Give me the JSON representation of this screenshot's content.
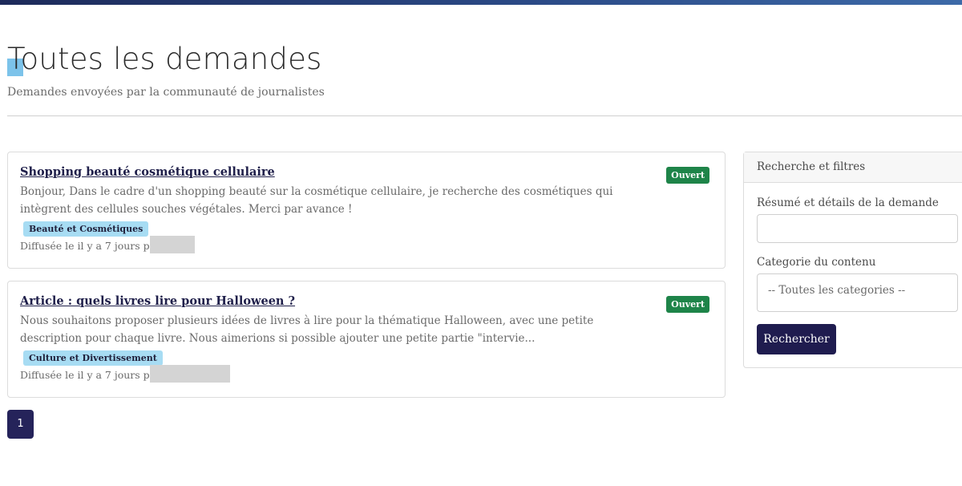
{
  "header": {
    "title": "Toutes les demandes",
    "subtitle": "Demandes envoyées par la communauté de journalistes"
  },
  "requests": [
    {
      "title": "Shopping beauté cosmétique cellulaire",
      "status": "Ouvert",
      "description": "Bonjour, Dans le cadre d'un shopping beauté sur la cosmétique cellulaire, je recherche des cosmétiques qui intègrent des cellules souches végétales. Merci par avance !",
      "category": "Beauté et Cosmétiques",
      "meta": "Diffusée le il y a 7 jours par"
    },
    {
      "title": "Article : quels livres lire pour Halloween ?",
      "status": "Ouvert",
      "description": "Nous souhaitons proposer plusieurs idées de livres à lire pour la thématique Halloween, avec une petite description pour chaque livre. Nous aimerions si possible ajouter une petite partie \"intervie...",
      "category": "Culture et Divertissement",
      "meta": "Diffusée le il y a 7 jours par"
    }
  ],
  "pagination": {
    "current_page": "1"
  },
  "filters": {
    "header": "Recherche et filtres",
    "summary_label": "Résumé et détails de la demande",
    "summary_value": "",
    "category_label": "Categorie du contenu",
    "category_selected": "-- Toutes les categories --",
    "search_button": "Rechercher"
  },
  "colors": {
    "primary": "#1f1c4f",
    "status_open": "#1e8449",
    "tag_bg": "#a7dcf3"
  }
}
